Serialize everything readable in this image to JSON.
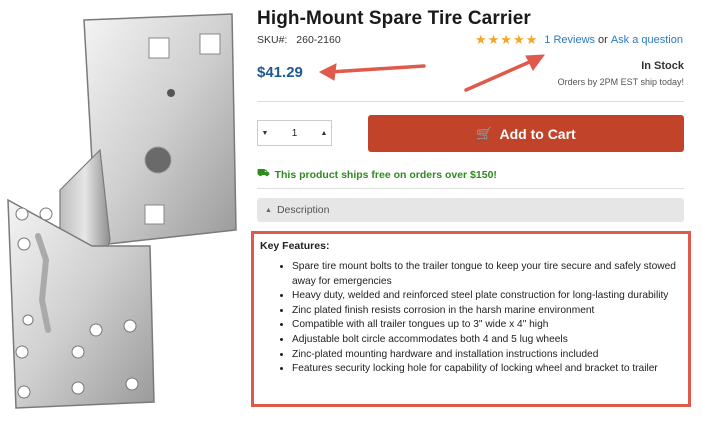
{
  "product": {
    "title": "High-Mount Spare Tire Carrier",
    "sku_label": "SKU#:",
    "sku_value": "260-2160",
    "price": "$41.29",
    "stock_status": "In Stock",
    "ship_note": "Orders by 2PM EST ship today!"
  },
  "rating": {
    "stars": "★★★★★",
    "star_count": 5,
    "reviews_link": "1 Reviews",
    "separator": "or",
    "ask_link": "Ask a question"
  },
  "cart": {
    "quantity": "1",
    "add_to_cart_label": "Add to Cart"
  },
  "shipping": {
    "free_shipping_text": "This product ships free on orders over $150!"
  },
  "description": {
    "tab_label": "Description"
  },
  "features": {
    "heading": "Key Features:",
    "items": [
      "Spare tire mount bolts to the trailer tongue to keep your tire secure and safely stowed away for emergencies",
      "Heavy duty, welded and reinforced steel plate construction for long-lasting durability",
      "Zinc plated finish resists corrosion in the harsh marine environment",
      "Compatible with all trailer tongues up to 3\" wide x 4\" high",
      "Adjustable bolt circle accommodates both 4 and 5 lug wheels",
      "Zinc-plated mounting hardware and installation instructions included",
      "Features security locking hole for capability of locking wheel and bracket to trailer"
    ]
  },
  "colors": {
    "accent_red": "#c0432a",
    "annotation_red": "#e05a4c",
    "price_blue": "#1e5a92",
    "link_blue": "#2b7bbf",
    "star_gold": "#f5a623",
    "ship_green": "#2e8a1f"
  },
  "icons": {
    "cart": "shopping-cart-icon",
    "truck": "truck-icon",
    "caret": "caret-up-icon"
  }
}
